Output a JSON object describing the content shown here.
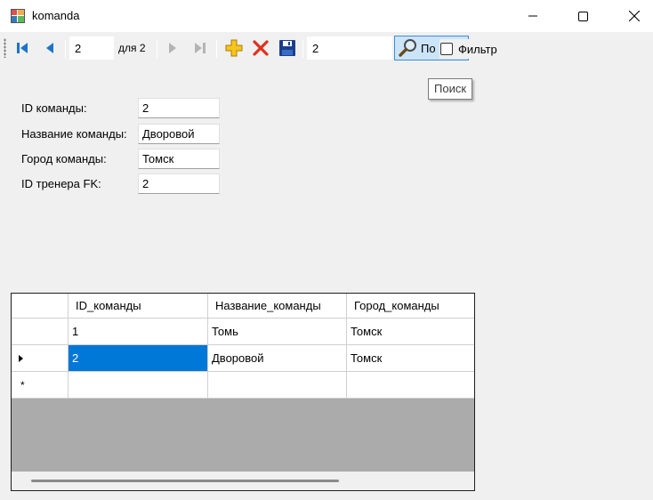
{
  "window": {
    "title": "komanda",
    "minimize_icon": "minimize-icon",
    "maximize_icon": "maximize-icon",
    "close_icon": "close-icon"
  },
  "toolbar": {
    "position_value": "2",
    "count_label": "для 2",
    "search_value": "2",
    "search_button_label": "По",
    "filter_label": "Фильтр",
    "filter_checked": false,
    "icons": [
      "move-first-icon",
      "move-previous-icon",
      "move-next-icon",
      "move-last-icon",
      "add-new-icon",
      "delete-icon",
      "save-icon",
      "search-icon"
    ]
  },
  "tooltip": {
    "text": "Поиск"
  },
  "form": {
    "fields": [
      {
        "label": "ID команды:",
        "value": "2"
      },
      {
        "label": "Название команды:",
        "value": "Дворовой"
      },
      {
        "label": "Город команды:",
        "value": "Томск"
      },
      {
        "label": "ID тренера FK:",
        "value": "2"
      }
    ]
  },
  "grid": {
    "columns": [
      "ID_команды",
      "Название_команды",
      "Город_команды"
    ],
    "rows": [
      [
        "1",
        "Томь",
        "Томск"
      ],
      [
        "2",
        "Дворовой",
        "Томск"
      ]
    ],
    "current_row_marker": "▶",
    "new_row_marker": "*",
    "selection_color": "#0078d7"
  }
}
